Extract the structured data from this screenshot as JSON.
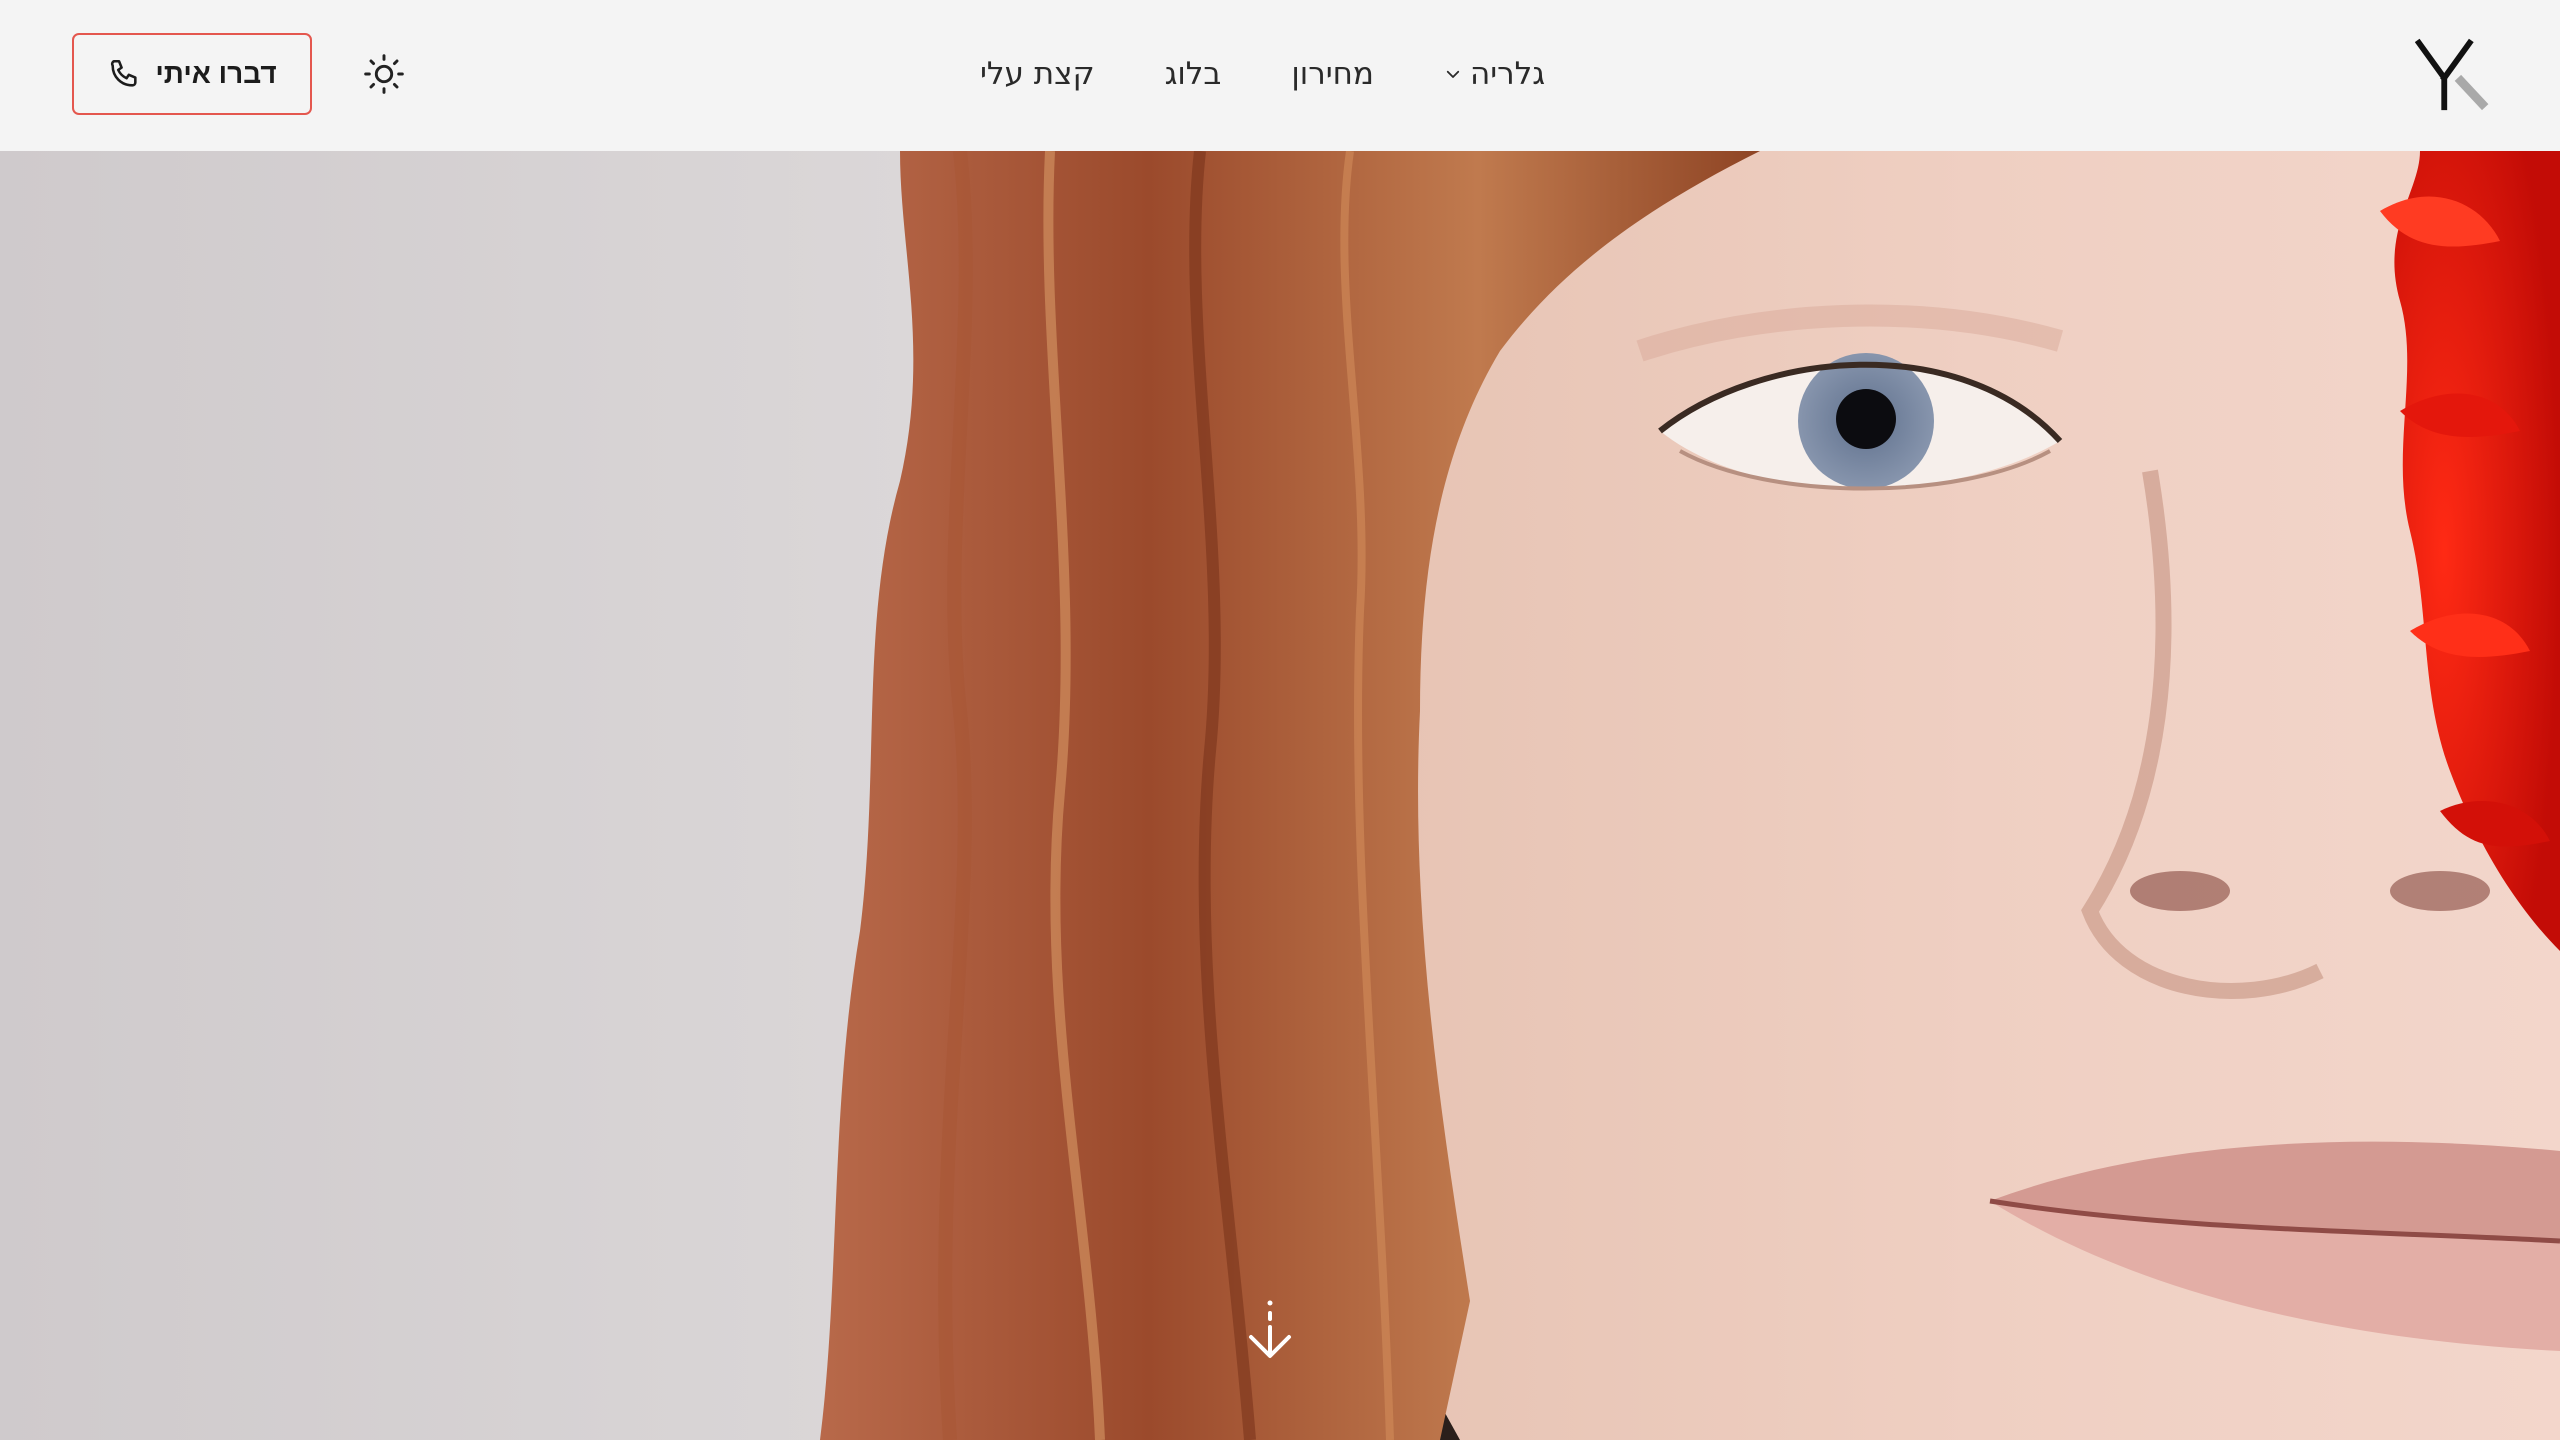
{
  "header": {
    "cta_label": "דברו איתי",
    "cta_icon": "phone-icon",
    "theme_toggle_icon": "sun-icon",
    "nav": [
      {
        "label": "קצת עלי"
      },
      {
        "label": "בלוג"
      },
      {
        "label": "מחירון"
      },
      {
        "label": "גלריה",
        "icon": "chevron-down-icon"
      }
    ],
    "logo_icon": "y-logo-icon"
  },
  "hero": {
    "image": "close-up portrait of a red-haired girl with a red flower over her eye",
    "scroll_icon": "arrow-down-icon"
  },
  "colors": {
    "accent": "#e4574e",
    "header_bg": "#f4f4f4",
    "text": "#1c1c1c"
  }
}
